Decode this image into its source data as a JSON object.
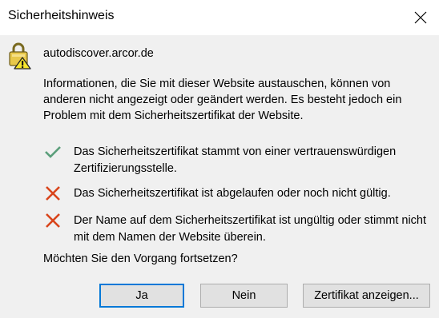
{
  "dialog": {
    "title": "Sicherheitshinweis",
    "host": "autodiscover.arcor.de",
    "info": "Informationen, die Sie mit dieser Website austauschen, können von anderen nicht angezeigt oder geändert werden. Es besteht jedoch ein Problem mit dem Sicherheitszertifikat der Website.",
    "items": [
      {
        "status": "ok",
        "icon": "check-icon",
        "text": "Das Sicherheitszertifikat stammt von einer vertrauenswürdigen Zertifizierungsstelle."
      },
      {
        "status": "error",
        "icon": "x-icon",
        "text": "Das Sicherheitszertifikat ist abgelaufen oder noch nicht gültig."
      },
      {
        "status": "error",
        "icon": "x-icon",
        "text": "Der Name auf dem Sicherheitszertifikat ist ungültig oder stimmt nicht mit dem Namen der Website überein."
      }
    ],
    "question": "Möchten Sie den Vorgang fortsetzen?"
  },
  "buttons": {
    "yes": "Ja",
    "no": "Nein",
    "view_cert": "Zertifikat anzeigen..."
  },
  "colors": {
    "ok": "#5a9e7a",
    "error": "#d9451c",
    "accent": "#0078d7"
  }
}
